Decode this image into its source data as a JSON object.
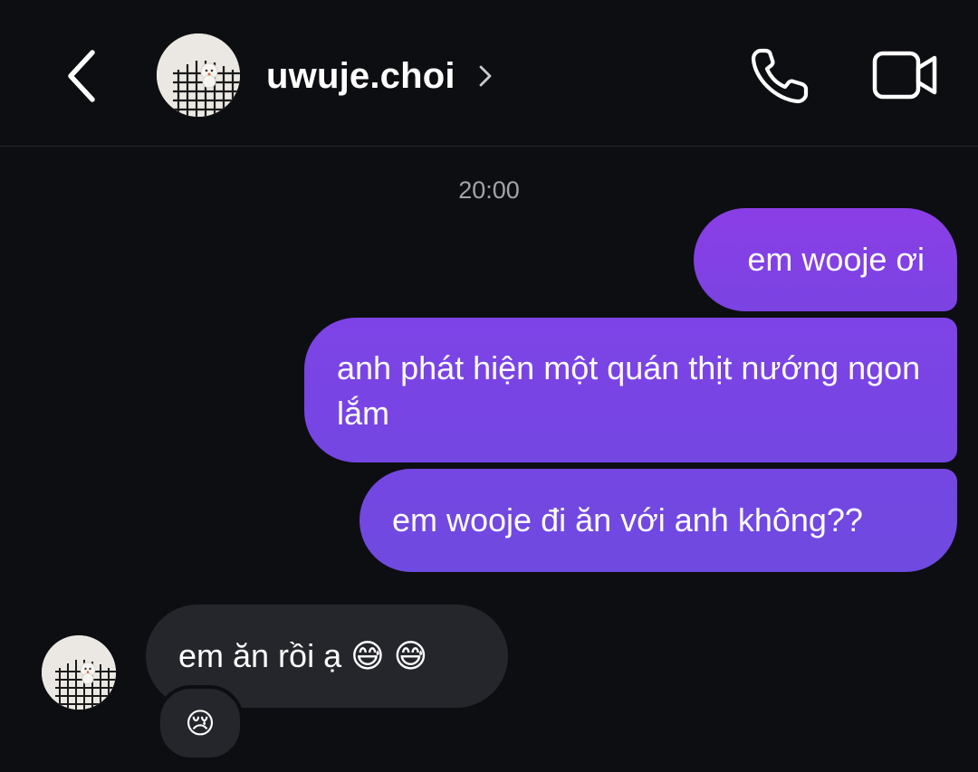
{
  "header": {
    "username": "uwuje.choi",
    "icons": {
      "back": "chevron-left-icon",
      "profile_chevron": "chevron-right-icon",
      "call": "phone-icon",
      "video": "video-camera-icon"
    }
  },
  "chat": {
    "timestamp": "20:00",
    "sent_messages": [
      {
        "text": "em wooje ơi"
      },
      {
        "text": "anh phát hiện một quán thịt nướng ngon lắm"
      },
      {
        "text": "em wooje đi ăn với anh không??"
      }
    ],
    "received_message": {
      "text": "em ăn rồi ạ",
      "emojis": [
        "😅",
        "😅"
      ]
    },
    "reaction": "😢"
  },
  "colors": {
    "background": "#0d0e12",
    "sent_bubble": "#7e43e6",
    "received_bubble": "#25262c",
    "timestamp": "#a3a4a9"
  }
}
